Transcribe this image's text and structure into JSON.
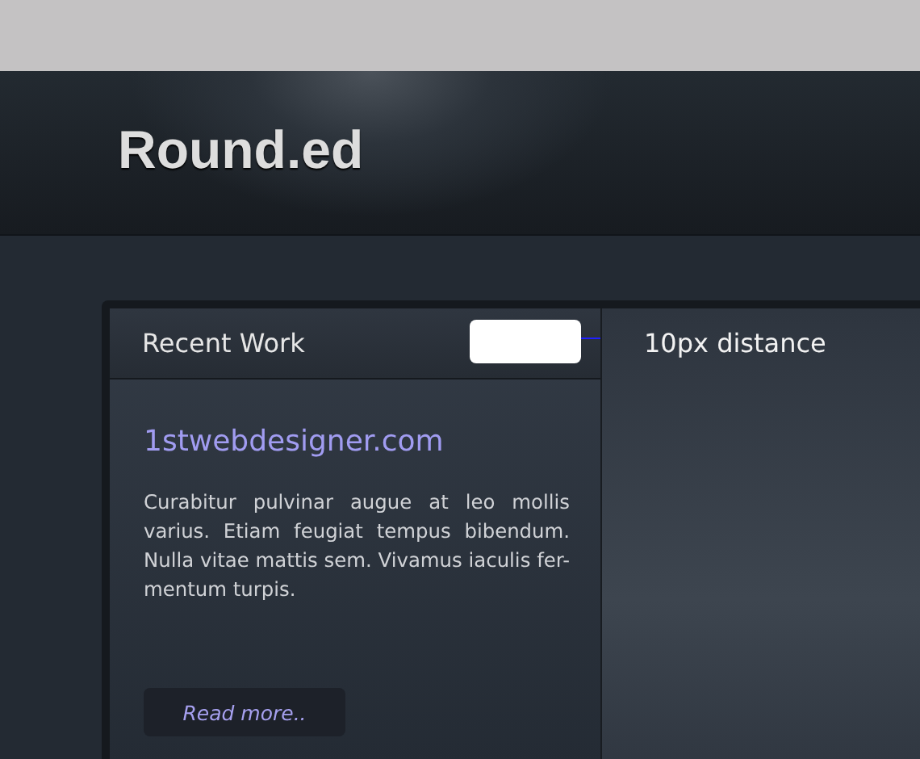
{
  "header": {
    "logo": "Round.ed"
  },
  "panel": {
    "title": "Recent Work",
    "link": "1stwebdesigner.com",
    "text": "Curabitur pulvinar augue at leo mollis varius. Etiam feugiat tempus bibendum. Nulla vitae mattis sem. Vivamus iaculis fer-mentum turpis.",
    "button": "Read more.."
  },
  "annotation": {
    "text": "10px distance"
  }
}
